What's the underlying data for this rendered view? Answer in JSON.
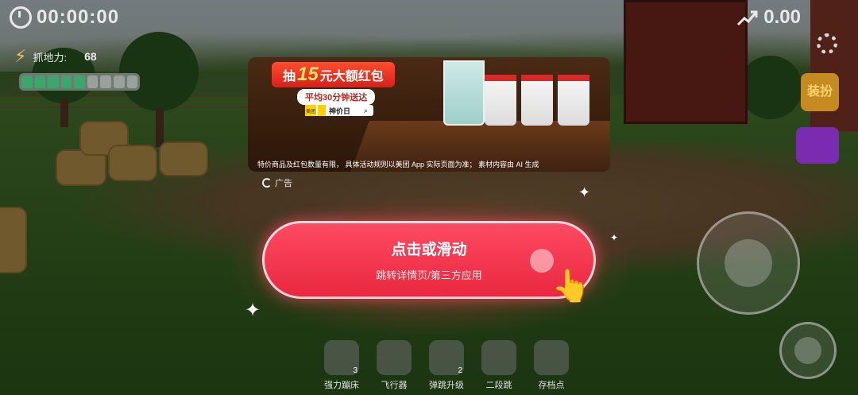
{
  "hud": {
    "timer": "00:00:00",
    "score": "0.00",
    "grip_label": "抓地力:",
    "grip_value": "68",
    "grip_level": 0.6
  },
  "ad": {
    "headline_prefix": "抽",
    "headline_number": "15",
    "headline_suffix": "元大额红包",
    "subline": "平均30分钟送达",
    "search_brand": "美团",
    "search_query": "神价日",
    "disclaimer": "特价商品及红包数量有限， 具体活动规则以美团 App 实际页面为准； 素材内容由 AI 生成",
    "ad_label": "广告",
    "cta_title": "点击或滑动",
    "cta_subtitle": "跳转详情页/第三方应用"
  },
  "side": {
    "dress_label": "装扮"
  },
  "skills": [
    {
      "name": "强力蹦床",
      "count": "3"
    },
    {
      "name": "飞行器",
      "count": ""
    },
    {
      "name": "弹跳升级",
      "count": "2"
    },
    {
      "name": "二段跳",
      "count": ""
    },
    {
      "name": "存档点",
      "count": ""
    }
  ],
  "icons": {
    "timer": "clock-icon",
    "score": "trend-up-icon",
    "grip": "lightning-icon",
    "settings": "gear-icon",
    "joystick": "chick-icon",
    "jump": "chick-icon",
    "pointer": "hand-pointer-icon"
  },
  "colors": {
    "cta": "#e8283e",
    "grip_fill": "#3aa86a",
    "ad_red": "#d8201a"
  }
}
